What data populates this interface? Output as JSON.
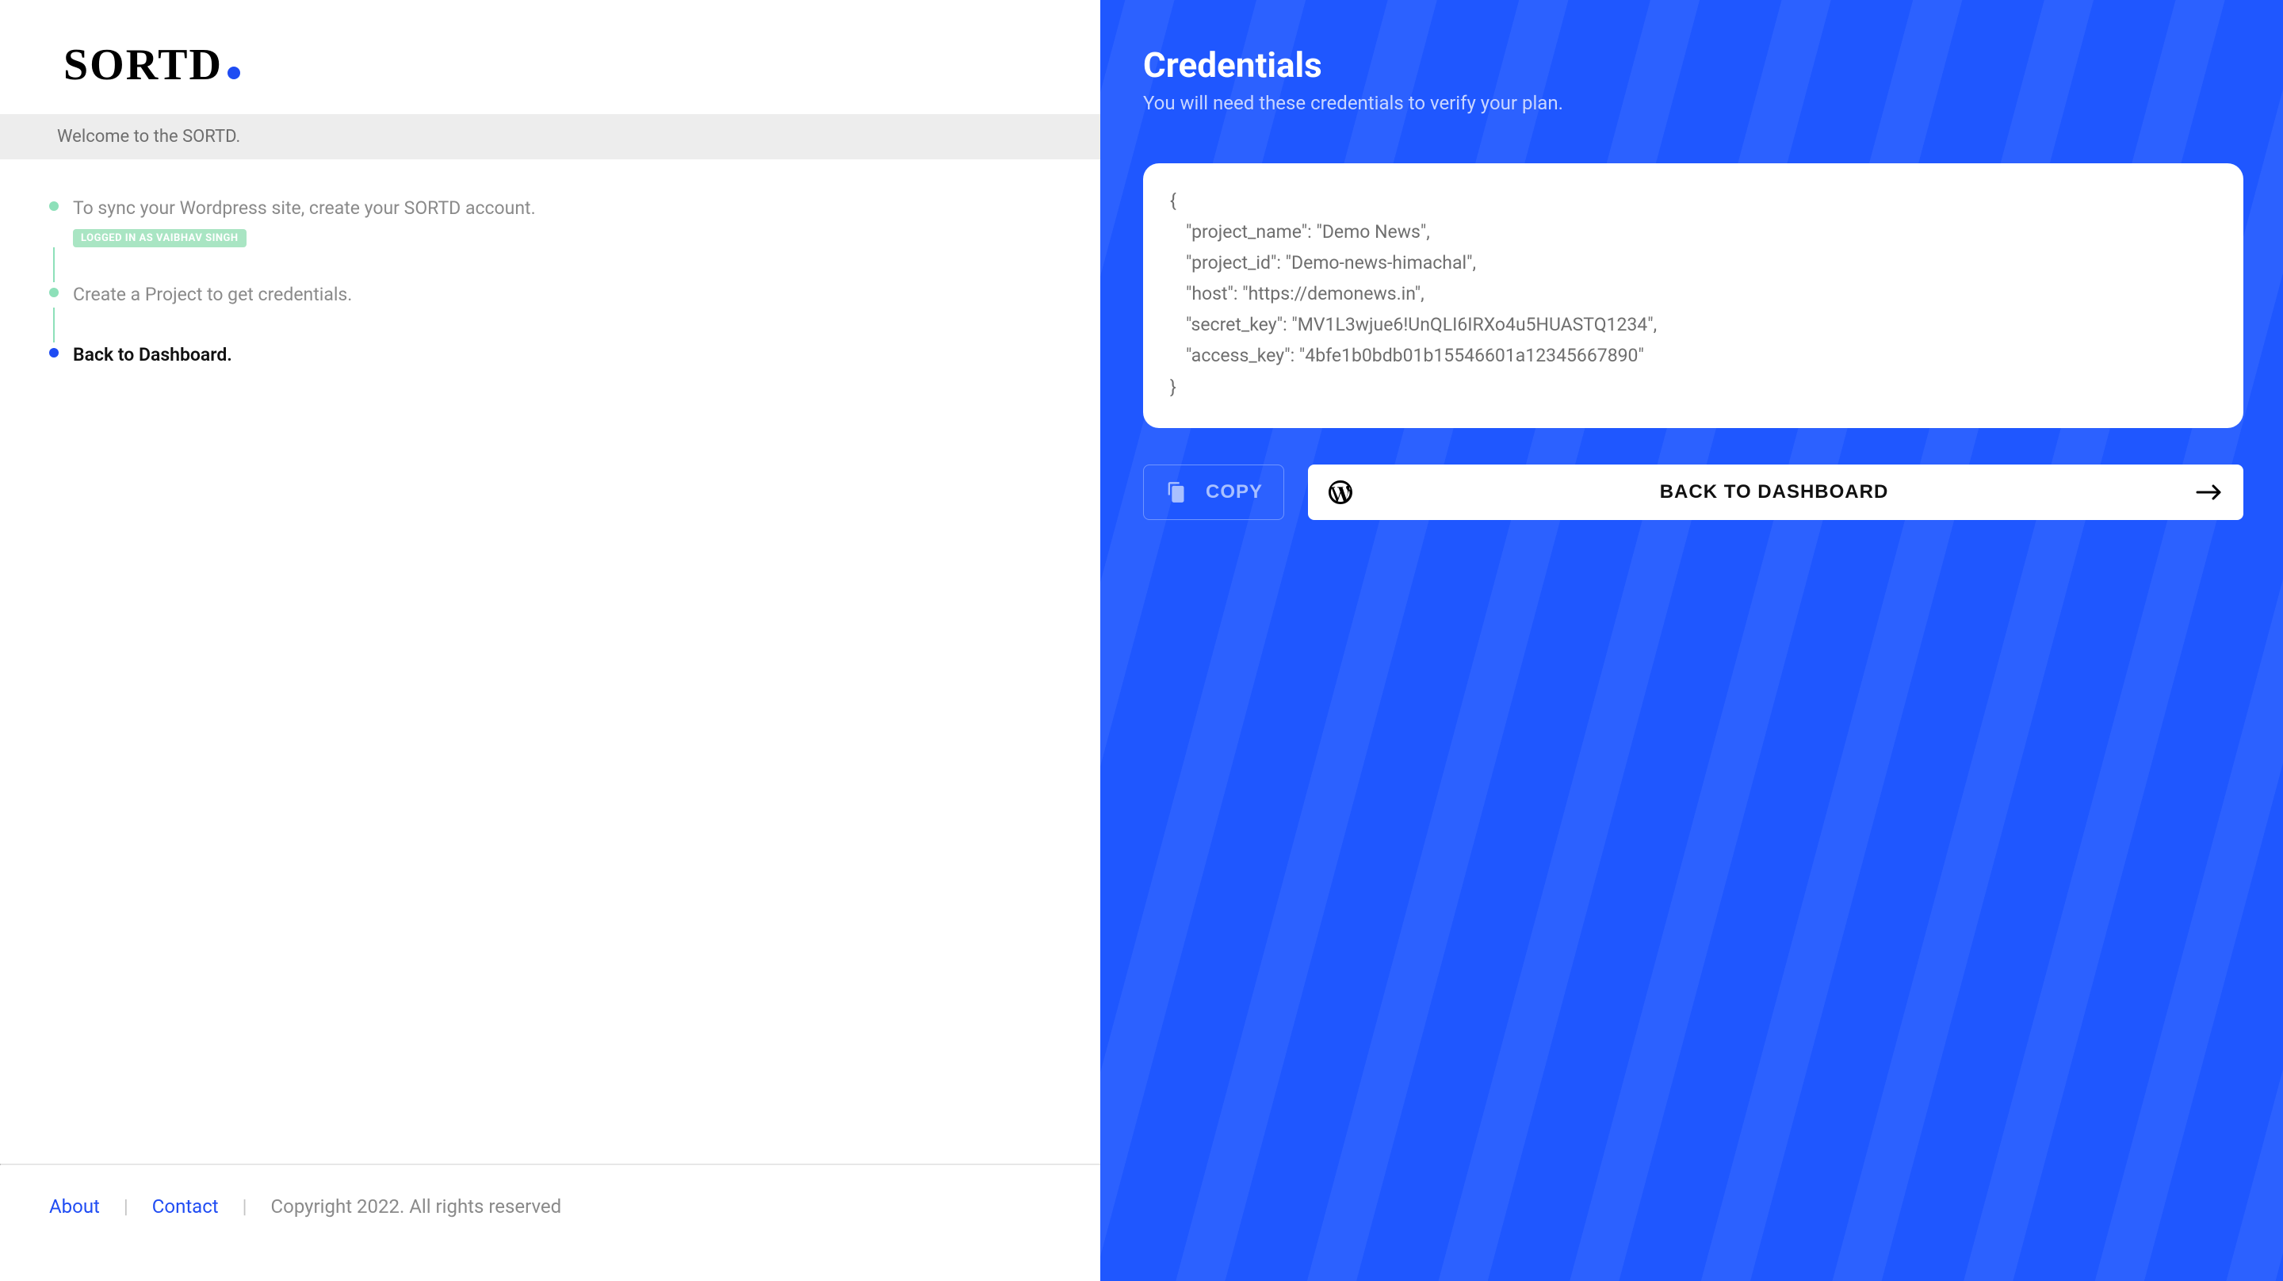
{
  "logo": {
    "text": "SORTD"
  },
  "welcome": "Welcome to the SORTD.",
  "steps": {
    "sync": "To sync your Wordpress site, create your SORTD account.",
    "badge": "LOGGED IN AS VAIBHAV SINGH",
    "create": "Create a Project to get credentials.",
    "back": "Back to Dashboard."
  },
  "footer": {
    "about": "About",
    "contact": "Contact",
    "copy": "Copyright 2022. All rights reserved"
  },
  "credentials": {
    "title": "Credentials",
    "subtitle": "You will need these credentials to verify your plan.",
    "json": {
      "project_name": "Demo News",
      "project_id": "Demo-news-himachal",
      "host": "https://demonews.in",
      "secret_key": "MV1L3wjue6!UnQLI6IRXo4u5HUASTQ1234",
      "access_key": "4bfe1b0bdb01b15546601a12345667890"
    },
    "copy_label": "COPY",
    "dash_label": "BACK TO DASHBOARD"
  }
}
